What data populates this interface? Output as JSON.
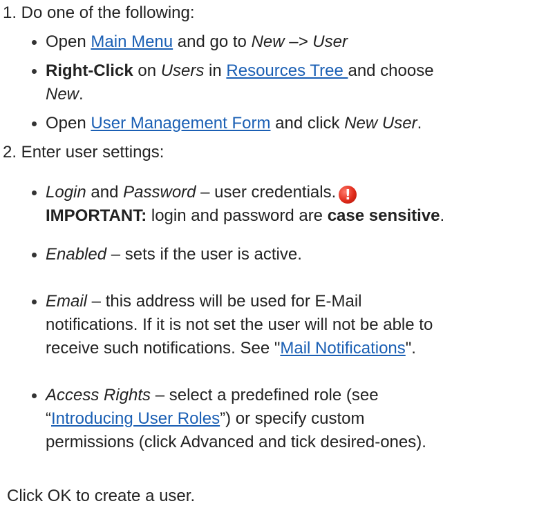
{
  "step1": {
    "label": "1. Do one of the following:",
    "bullets": [
      {
        "prefix": "Open ",
        "link": "Main Menu",
        "middle": " and go to ",
        "path": "New –> User"
      },
      {
        "strong": "Right-Click",
        "on": " on ",
        "users": "Users",
        "in": " in ",
        "link": "Resources Tree ",
        "suffix": "and choose",
        "choice": "New",
        "end": "."
      },
      {
        "prefix": "Open ",
        "link": "User Management Form",
        "middle": " and click ",
        "action": "New User",
        "end": "."
      }
    ]
  },
  "step2": {
    "label": "2. Enter user settings:",
    "bullets": [
      {
        "term1": "Login",
        "and": " and ",
        "term2": "Password",
        "desc": " – user credentials.",
        "icon": "alert-icon",
        "icon_glyph": "!",
        "important_label": "IMPORTANT:",
        "important_text": " login and password are ",
        "important_strong": "case sensitive",
        "important_end": "."
      },
      {
        "term": "Enabled",
        "desc": " – sets if the user is active."
      },
      {
        "term": "Email",
        "line1": " – this address will be used for E-Mail",
        "line2": "notifications. If it is not set the user will not be able to",
        "line3_prefix": "receive such notifications. See \"",
        "link": "Mail Notifications",
        "line3_suffix": "\"."
      },
      {
        "term": "Access Rights",
        "line1": " – select a predefined role (see",
        "line2_prefix": "“",
        "link": "Introducing User Roles",
        "line2_suffix": "”) or specify custom",
        "line3": "permissions (click Advanced and tick desired-ones)."
      }
    ]
  },
  "footer": {
    "text": "Click OK to create a user."
  },
  "colors": {
    "link": "#1a5fb4",
    "text": "#222222",
    "alert": "#e02a1a"
  }
}
